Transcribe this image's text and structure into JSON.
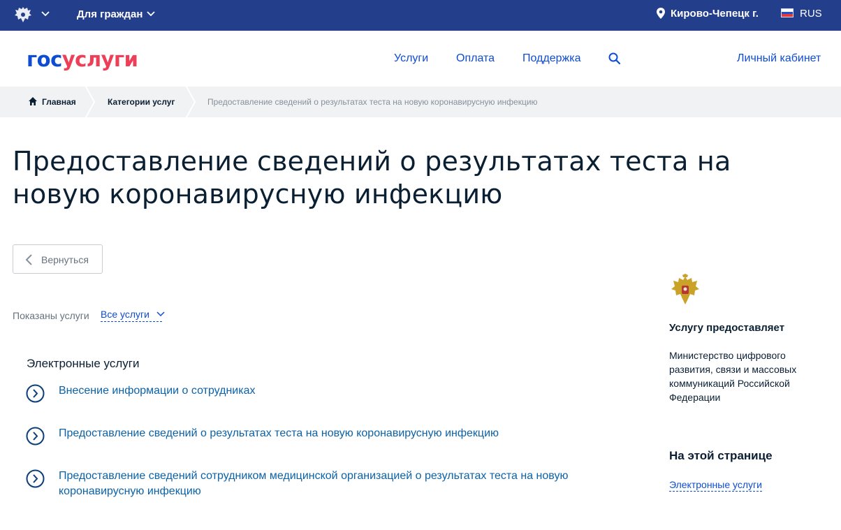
{
  "colors": {
    "topbar_bg": "#233e8b",
    "brand_blue": "#0d4cd3",
    "brand_red": "#ee3f58",
    "link_blue": "#0b62a8",
    "breadcrumb_bg": "#f1f2f4"
  },
  "topbar": {
    "emblem_icon": "russian-emblem-icon",
    "audience_label": "Для граждан",
    "location_icon": "map-pin-icon",
    "city": "Кирово-Чепецк г.",
    "language_flag_icon": "russia-flag-icon",
    "language": "RUS"
  },
  "header": {
    "logo_part1": "гос",
    "logo_part2": "услуги",
    "nav": [
      "Услуги",
      "Оплата",
      "Поддержка"
    ],
    "search_icon": "search-icon",
    "cabinet_label": "Личный кабинет"
  },
  "breadcrumbs": {
    "home": "Главная",
    "category": "Категории услуг",
    "current": "Предоставление сведений о результатах теста на новую коронавирусную инфекцию"
  },
  "page": {
    "title": "Предоставление сведений о результатах теста на новую коронавирусную инфекцию",
    "back_label": "Вернуться",
    "filter_label": "Показаны услуги",
    "filter_value": "Все услуги"
  },
  "services": {
    "section_title": "Электронные услуги",
    "items": [
      "Внесение информации о сотрудниках",
      "Предоставление сведений о результатах теста на новую коронавирусную инфекцию",
      "Предоставление сведений сотрудником медицинской организацией о результатах теста на новую коронавирусную инфекцию"
    ]
  },
  "sidebar": {
    "provider_title": "Услугу предоставляет",
    "provider": "Министерство цифрового развития, связи и массовых коммуникаций Российской Федерации",
    "toc_title": "На этой странице",
    "toc_link": "Электронные услуги"
  }
}
